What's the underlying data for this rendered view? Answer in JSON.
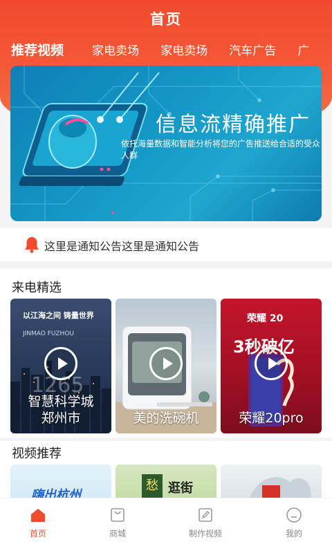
{
  "header": {
    "title": "首页",
    "tabs": [
      {
        "label": "推荐视频",
        "active": true
      },
      {
        "label": "家电卖场"
      },
      {
        "label": "家电卖场"
      },
      {
        "label": "汽车广告"
      },
      {
        "label": "广"
      }
    ]
  },
  "banner": {
    "title": "信息流精确推广",
    "subtitle": "依托海量数据和智能分析将您的广告推送给合适的受众人群"
  },
  "notice": {
    "icon": "bell-icon",
    "text": "这里是通知公告这里是通知公告"
  },
  "featured": {
    "title": "来电精选",
    "items": [
      {
        "caption_line1": "智慧科学城",
        "caption_line2": "郑州市",
        "art_text_1": "以江海之间  铸量世界",
        "art_text_2": "JINMAO FUZHOU",
        "art_text_3": "1265"
      },
      {
        "caption_line1": "美的洗碗机"
      },
      {
        "caption_line1": "荣耀20pro",
        "art_text_1": "荣耀 20",
        "art_text_2": "3秒破亿"
      }
    ]
  },
  "recommend": {
    "title": "视频推荐",
    "items": [
      {
        "art_text": "嗨出杭州"
      },
      {
        "art_text_1": "愁",
        "art_text_2": "逛街"
      },
      {
        "art_text": ""
      }
    ]
  },
  "bottom_nav": {
    "items": [
      {
        "label": "首页",
        "icon": "home-icon",
        "active": true
      },
      {
        "label": "商城",
        "icon": "shopping-bag-icon"
      },
      {
        "label": "制作视频",
        "icon": "edit-icon"
      },
      {
        "label": "我的",
        "icon": "user-face-icon"
      }
    ]
  },
  "colors": {
    "accent": "#f24a2f",
    "banner_blue": "#1395c4"
  }
}
